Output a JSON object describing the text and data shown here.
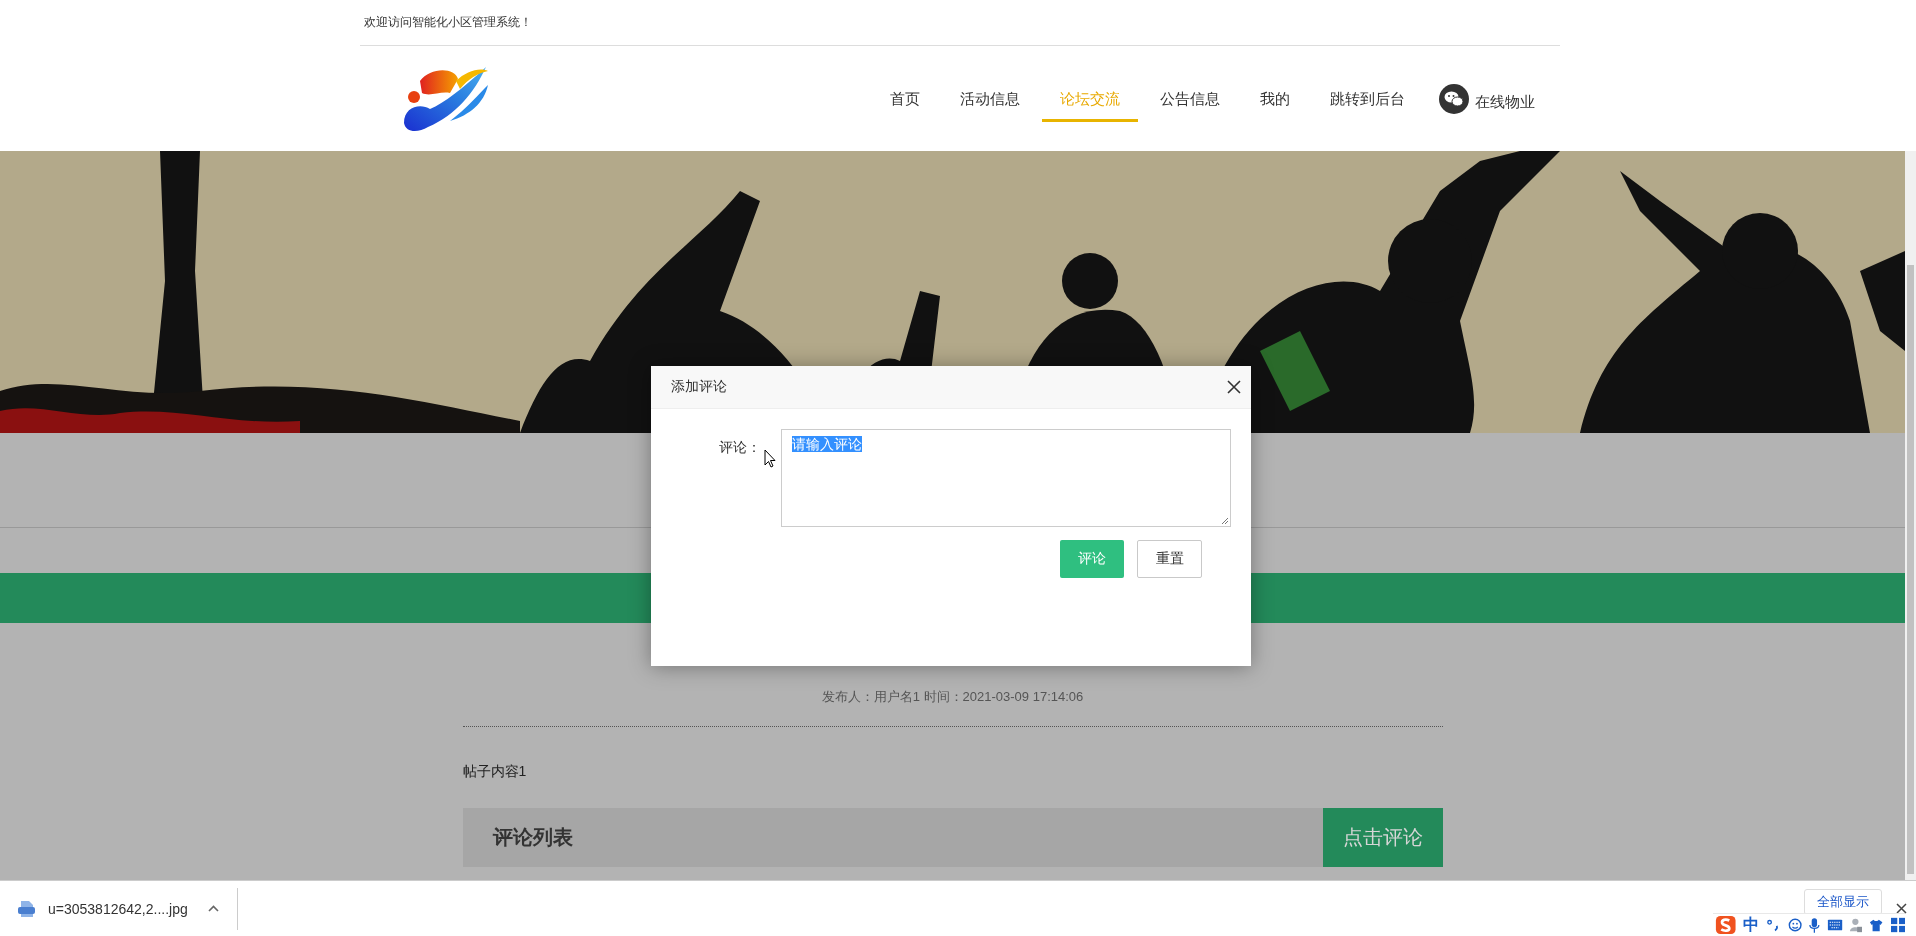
{
  "top_bar": {
    "welcome": "欢迎访问智能化小区管理系统！"
  },
  "nav": {
    "items": [
      {
        "label": "首页",
        "selected": false
      },
      {
        "label": "活动信息",
        "selected": false
      },
      {
        "label": "论坛交流",
        "selected": true
      },
      {
        "label": "公告信息",
        "selected": false
      },
      {
        "label": "我的",
        "selected": false
      },
      {
        "label": "跳转到后台",
        "selected": false
      }
    ],
    "online_service": "在线物业"
  },
  "post": {
    "meta": "发布人：用户名1 时间：2021-03-09 17:14:06",
    "content": "帖子内容1",
    "comments_heading": "评论列表",
    "comment_button": "点击评论"
  },
  "dialog": {
    "title": "添加评论",
    "label": "评论：",
    "field": {
      "value": "请输入评论",
      "text_selected": true
    },
    "buttons": [
      {
        "label": "评论",
        "kind": "primary"
      },
      {
        "label": "重置",
        "kind": "default"
      }
    ]
  },
  "download_bar": {
    "file": "u=3053812642,2....jpg",
    "show_all": "全部显示"
  },
  "ime_toolbar": {
    "mode": "中"
  }
}
